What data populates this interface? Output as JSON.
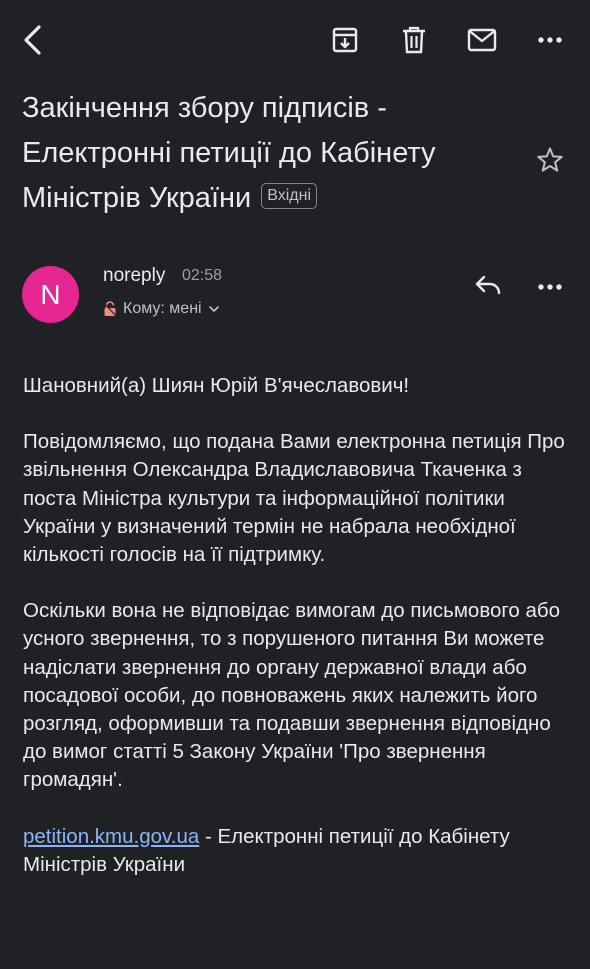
{
  "toolbar": {
    "back_icon": "back-arrow-icon",
    "archive_icon": "archive-icon",
    "delete_icon": "trash-icon",
    "mail_icon": "mark-unread-icon",
    "more_icon": "more-horizontal-icon"
  },
  "email": {
    "subject": "Закінчення збору підписів - Електронні петиції до Кабінету Міністрів України",
    "label": "Вхідні",
    "sender": {
      "initial": "N",
      "name": "noreply",
      "time": "02:58",
      "to": "Кому: мені",
      "avatar_color": "#e52592"
    },
    "greeting": "Шановний(а) Шиян Юрій В'ячеславович!",
    "paragraph_1": "Повідомляємо, що подана Вами електронна петиція Про звільнення Олександра Владиславовича Ткаченка з поста Міністра культури та інформаційної політики України у визначений термін не набрала необхідної кількості голосів на її підтримку.",
    "paragraph_2": "Оскільки вона не відповідає вимогам до письмового або усного звернення, то з порушеного питання Ви можете надіслати звернення до органу державної влади або посадової особи, до повноважень яких належить його розгляд, оформивши та подавши звернення відповідно до вимог статті 5 Закону України 'Про звернення громадян'.",
    "footer_link": "petition.kmu.gov.ua",
    "footer_text": " - Електронні петиції до Кабінету Міністрів України"
  },
  "colors": {
    "background": "#202124",
    "text": "#e8eaed",
    "link": "#8ab4f8"
  }
}
